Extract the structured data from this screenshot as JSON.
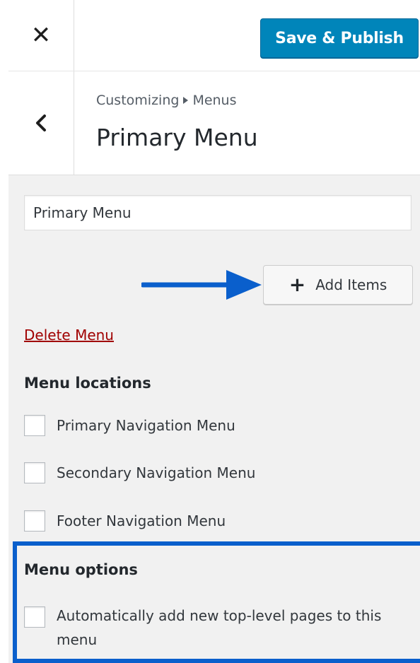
{
  "topbar": {
    "close_icon": "close-icon",
    "save_label": "Save & Publish",
    "accent": "#0085ba"
  },
  "header": {
    "breadcrumb_root": "Customizing",
    "breadcrumb_section": "Menus",
    "title": "Primary Menu"
  },
  "menu": {
    "name_value": "Primary Menu",
    "add_items_label": "Add Items",
    "delete_label": "Delete Menu",
    "locations_heading": "Menu locations",
    "locations": [
      {
        "label": "Primary Navigation Menu",
        "checked": false
      },
      {
        "label": "Secondary Navigation Menu",
        "checked": false
      },
      {
        "label": "Footer Navigation Menu",
        "checked": false
      }
    ],
    "options_heading": "Menu options",
    "auto_add_label": "Automatically add new top-level pages to this menu",
    "auto_add_checked": false
  },
  "annotation": {
    "highlight_color": "#0a5fcc"
  }
}
